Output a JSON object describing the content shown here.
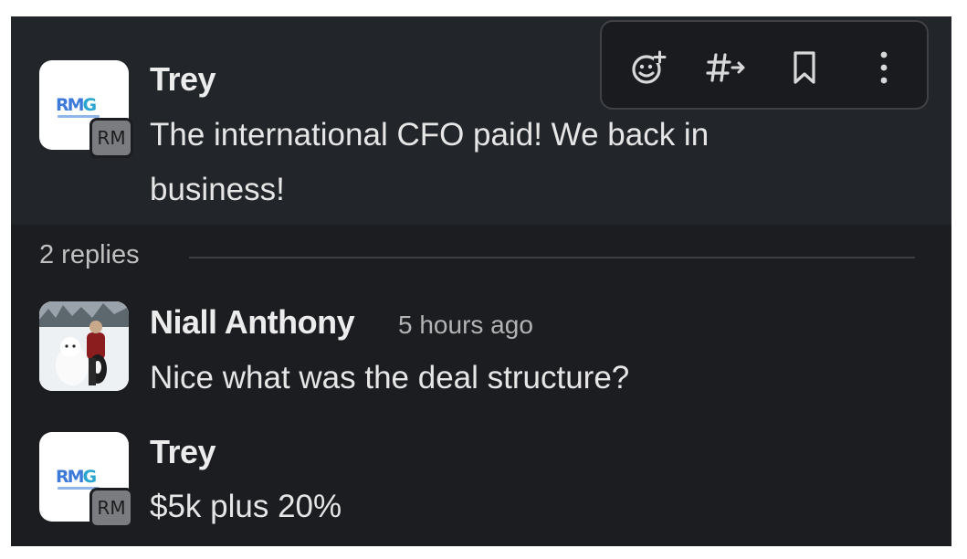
{
  "parent_message": {
    "sender": "Trey",
    "avatar_text": "RMG",
    "badge": "RM",
    "text_line1": "The international CFO paid! We back in",
    "text_line2": "business!"
  },
  "toolbar": {
    "actions": [
      "add-reaction-icon",
      "forward-to-channel-icon",
      "bookmark-icon",
      "more-actions-icon"
    ]
  },
  "thread": {
    "replies_label": "2 replies",
    "replies": [
      {
        "sender": "Niall Anthony",
        "time": "5 hours ago",
        "text": "Nice what was the deal structure?"
      },
      {
        "sender": "Trey",
        "badge": "RM",
        "avatar_text": "RMG",
        "text": "$5k plus 20%"
      }
    ]
  },
  "colors": {
    "background": "#1c1d21",
    "parent_background": "#222529",
    "text": "#e6e6e6",
    "muted": "#b3b3b3"
  }
}
